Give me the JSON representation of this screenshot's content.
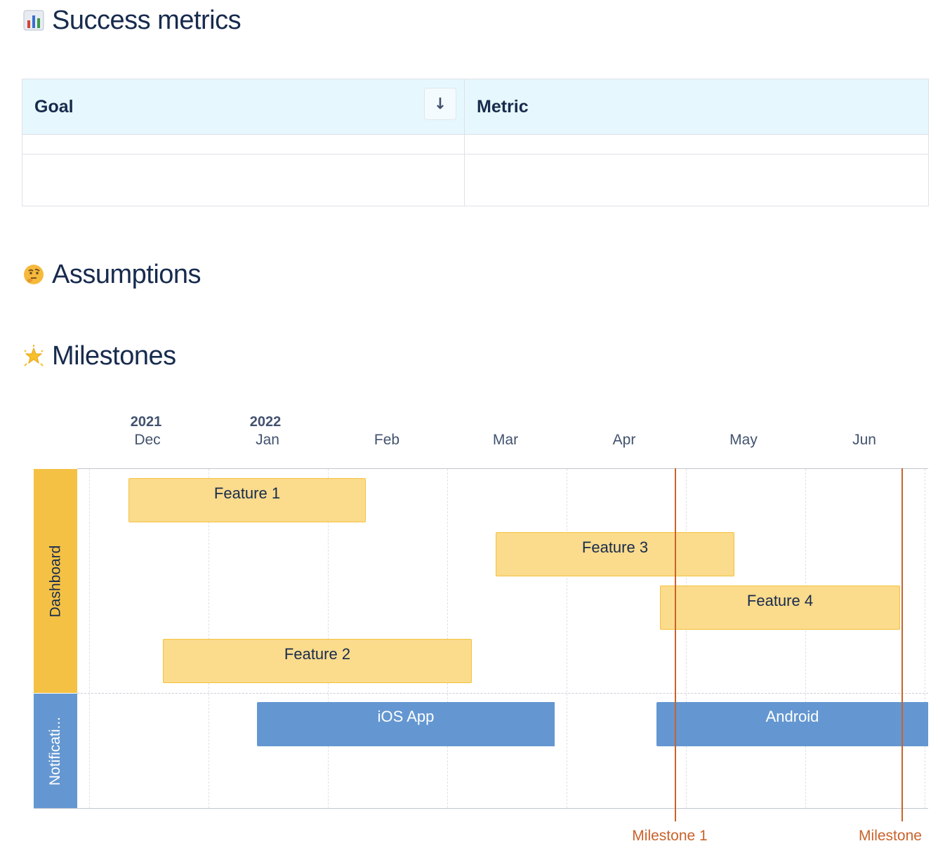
{
  "sections": {
    "success_metrics": "Success metrics",
    "assumptions": "Assumptions",
    "milestones": "Milestones"
  },
  "icons": {
    "success_metrics": "bar-chart-icon",
    "assumptions": "thinking-face-icon",
    "milestones": "glowing-star-icon",
    "sort": "arrow-down-icon"
  },
  "metrics_table": {
    "headers": [
      "Goal",
      "Metric"
    ],
    "sort_glyph": "↓",
    "rows": [
      [
        "",
        ""
      ],
      [
        "",
        ""
      ]
    ]
  },
  "timeline": {
    "years": [
      {
        "label": "2021",
        "month_index": 0
      },
      {
        "label": "2022",
        "month_index": 1
      }
    ],
    "months": [
      "Dec",
      "Jan",
      "Feb",
      "Mar",
      "Apr",
      "May",
      "Jun"
    ],
    "lanes": [
      {
        "label": "Dashboard",
        "color": "#f4c145"
      },
      {
        "label": "Notificati...",
        "color": "#6497d1"
      }
    ],
    "bars": [
      {
        "label": "Feature 1",
        "lane": "Dashboard"
      },
      {
        "label": "Feature 3",
        "lane": "Dashboard"
      },
      {
        "label": "Feature 4",
        "lane": "Dashboard"
      },
      {
        "label": "Feature 2",
        "lane": "Dashboard"
      },
      {
        "label": "iOS App",
        "lane": "Notificati..."
      },
      {
        "label": "Android",
        "lane": "Notificati..."
      }
    ],
    "milestones": [
      "Milestone 1",
      "Milestone"
    ],
    "colors": {
      "feature_bar": "#fbdb8c",
      "feature_border": "#f3c23f",
      "notification_bar": "#6497d1",
      "milestone": "#c9622b",
      "table_header": "#e6f8fd"
    }
  }
}
